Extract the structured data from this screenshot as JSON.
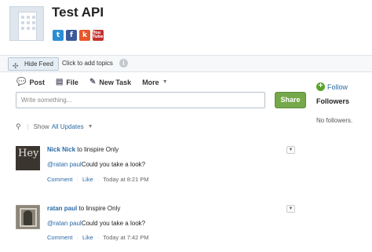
{
  "header": {
    "title": "Test API",
    "social_icons": [
      {
        "name": "twitter-icon",
        "label": "t"
      },
      {
        "name": "facebook-icon",
        "label": "f"
      },
      {
        "name": "klout-icon",
        "label": "k"
      },
      {
        "name": "youtube-icon",
        "label": "You Tube"
      }
    ]
  },
  "topic_bar": {
    "hide_feed": "Hide Feed",
    "add_topics": "Click to add topics",
    "info": "i"
  },
  "publisher": {
    "tabs": [
      {
        "label": "Post",
        "icon": "post-icon"
      },
      {
        "label": "File",
        "icon": "file-icon"
      },
      {
        "label": "New Task",
        "icon": "task-icon"
      },
      {
        "label": "More",
        "icon": "chevron-down-icon"
      }
    ],
    "placeholder": "Write something...",
    "share": "Share"
  },
  "right": {
    "follow": "Follow",
    "followers_heading": "Followers",
    "no_followers": "No followers."
  },
  "filter": {
    "show_label": "Show",
    "selected": "All Updates"
  },
  "feed": {
    "posts": [
      {
        "author": "Nick Nick",
        "target_text": "to linspire Only",
        "mention": "@ratan paul",
        "body": "Could you take a look?",
        "comment": "Comment",
        "like": "Like",
        "timestamp": "Today at 8:21 PM",
        "avatar_text": "Hey"
      },
      {
        "author": "ratan paul",
        "target_text": "to linspire Only",
        "mention": "@ratan paul",
        "body": "Could you take a look?",
        "comment": "Comment",
        "like": "Like",
        "timestamp": "Today at 7:42 PM"
      }
    ]
  },
  "colors": {
    "link": "#2a6aa6",
    "share_button": "#75a84a",
    "follow_plus": "#5aa42c"
  }
}
